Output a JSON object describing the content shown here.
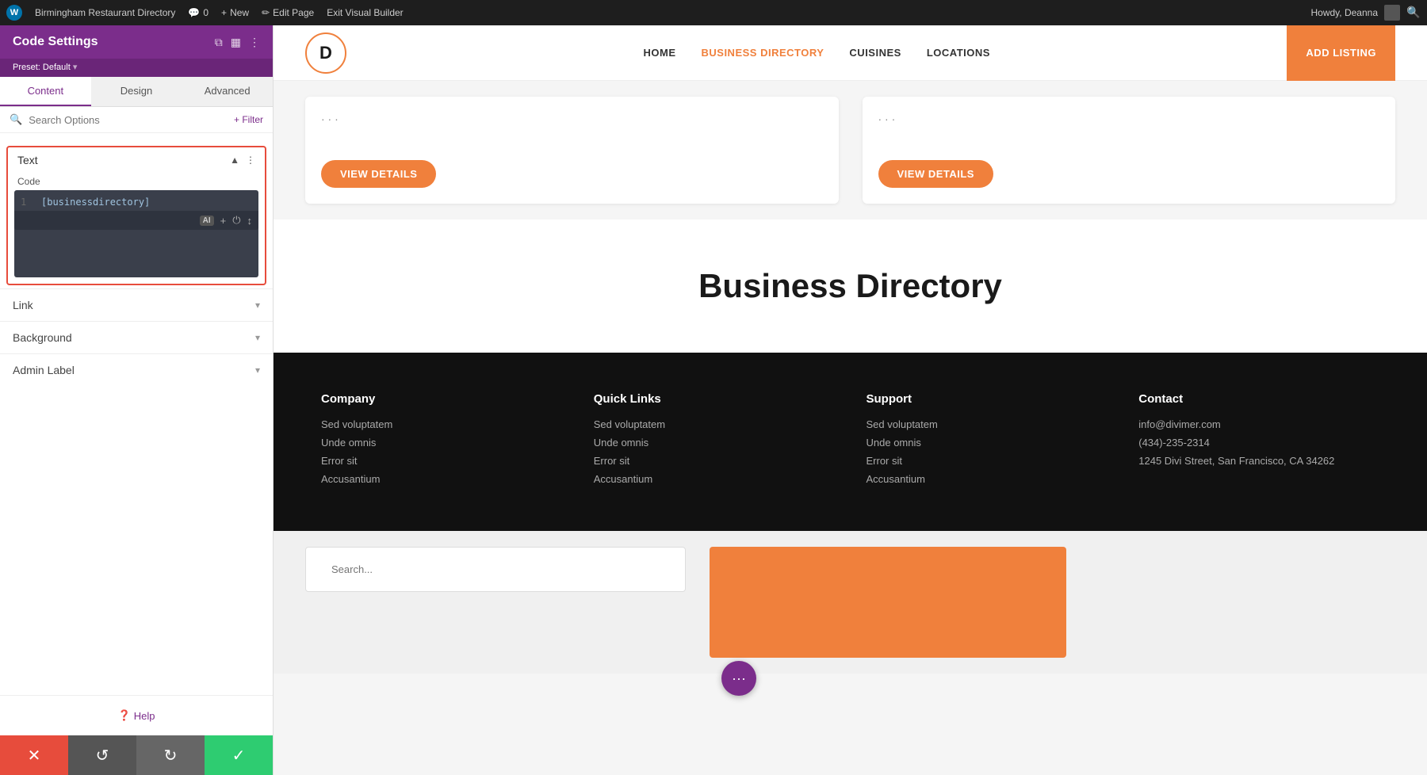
{
  "adminBar": {
    "wpIcon": "W",
    "siteName": "Birmingham Restaurant Directory",
    "commentCount": "0",
    "newLabel": "New",
    "editPage": "Edit Page",
    "exitBuilder": "Exit Visual Builder",
    "userGreeting": "Howdy, Deanna"
  },
  "sidebar": {
    "title": "Code Settings",
    "preset": "Preset: Default",
    "tabs": [
      "Content",
      "Design",
      "Advanced"
    ],
    "activeTab": "Content",
    "searchPlaceholder": "Search Options",
    "filterLabel": "+ Filter",
    "sections": {
      "text": {
        "label": "Text",
        "codeLabel": "Code",
        "codeLine": "[businessdirectory]",
        "lineNumber": "1"
      },
      "link": {
        "label": "Link"
      },
      "background": {
        "label": "Background"
      },
      "adminLabel": {
        "label": "Admin Label"
      }
    },
    "help": "Help"
  },
  "footer": {
    "cancelIcon": "✕",
    "undoIcon": "↺",
    "redoIcon": "↻",
    "saveIcon": "✓"
  },
  "nav": {
    "logoLetter": "D",
    "links": [
      "HOME",
      "BUSINESS DIRECTORY",
      "CUISINES",
      "LOCATIONS"
    ],
    "activeLink": "BUSINESS DIRECTORY",
    "addListingLabel": "ADD LISTING"
  },
  "cards": [
    {
      "viewButtonLabel": "VIEW DETAILS"
    },
    {
      "viewButtonLabel": "VIEW DETAILS"
    }
  ],
  "directorySection": {
    "title": "Business Directory"
  },
  "footerContent": {
    "columns": [
      {
        "title": "Company",
        "items": [
          "Sed voluptatem",
          "Unde omnis",
          "Error sit",
          "Accusantium"
        ]
      },
      {
        "title": "Quick Links",
        "items": [
          "Sed voluptatem",
          "Unde omnis",
          "Error sit",
          "Accusantium"
        ]
      },
      {
        "title": "Support",
        "items": [
          "Sed voluptatem",
          "Unde omnis",
          "Error sit",
          "Accusantium"
        ]
      },
      {
        "title": "Contact",
        "items": [
          "info@divimer.com",
          "(434)-235-2314",
          "1245 Divi Street, San Francisco, CA 34262"
        ]
      }
    ]
  },
  "fab": {
    "icon": "···"
  }
}
